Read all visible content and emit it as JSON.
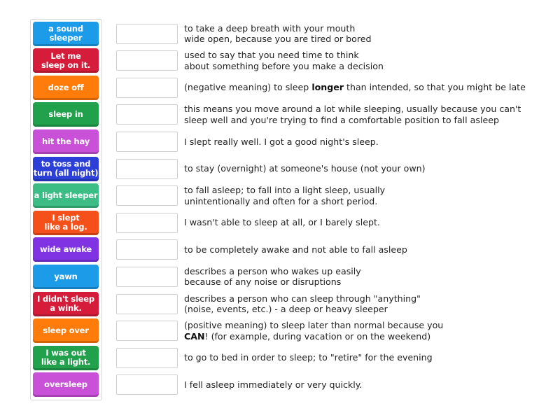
{
  "terms": [
    {
      "label": "a sound\nsleeper",
      "color": "#1b9be8"
    },
    {
      "label": "Let me\nsleep on it.",
      "color": "#d51d3b"
    },
    {
      "label": "doze off",
      "color": "#ff7b0a"
    },
    {
      "label": "sleep in",
      "color": "#22a14c"
    },
    {
      "label": "hit the hay",
      "color": "#c951d8"
    },
    {
      "label": "to toss and\nturn (all night)",
      "color": "#2c40d8"
    },
    {
      "label": "a light sleeper",
      "color": "#3dbd86"
    },
    {
      "label": "I slept\nlike a log.",
      "color": "#f5501a"
    },
    {
      "label": "wide awake",
      "color": "#7f33e3"
    },
    {
      "label": "yawn",
      "color": "#1b9be8"
    },
    {
      "label": "I didn't sleep\na wink.",
      "color": "#d51d3b"
    },
    {
      "label": "sleep over",
      "color": "#ff7b0a"
    },
    {
      "label": "I was out\nlike a light.",
      "color": "#22a14c"
    },
    {
      "label": "oversleep",
      "color": "#c951d8"
    }
  ],
  "definitions": [
    {
      "before": "to take a deep breath with your mouth\nwide open, because you are tired or bored"
    },
    {
      "before": "used to say that you need time to think\nabout something before you make a decision"
    },
    {
      "before": "(negative meaning) to sleep ",
      "bold": "longer",
      "after": " than intended, so that you might be late"
    },
    {
      "before": "this means you move around a lot while sleeping, usually because you can't\nsleep well and you're trying to find a comfortable position to fall asleep"
    },
    {
      "before": "I slept really well. I got a good night's sleep."
    },
    {
      "before": "to stay (overnight) at someone's house (not your own)"
    },
    {
      "before": "to fall asleep; to fall into a light sleep, usually\nunintentionally and often for a short period."
    },
    {
      "before": "I wasn't able to sleep at all, or I barely slept."
    },
    {
      "before": "to be completely awake and not able to fall asleep"
    },
    {
      "before": "describes a person who wakes up easily\nbecause of any noise or disruptions"
    },
    {
      "before": "describes a person who can sleep through \"anything\"\n(noise, events, etc.) - a deep or heavy sleeper"
    },
    {
      "before": "(positive meaning) to sleep later than normal because you\n",
      "bold": "CAN",
      "after": "! (for example, during vacation or on the weekend)"
    },
    {
      "before": "to go to bed in order to sleep; to \"retire\" for the evening"
    },
    {
      "before": "I fell asleep immediately or very quickly."
    }
  ]
}
